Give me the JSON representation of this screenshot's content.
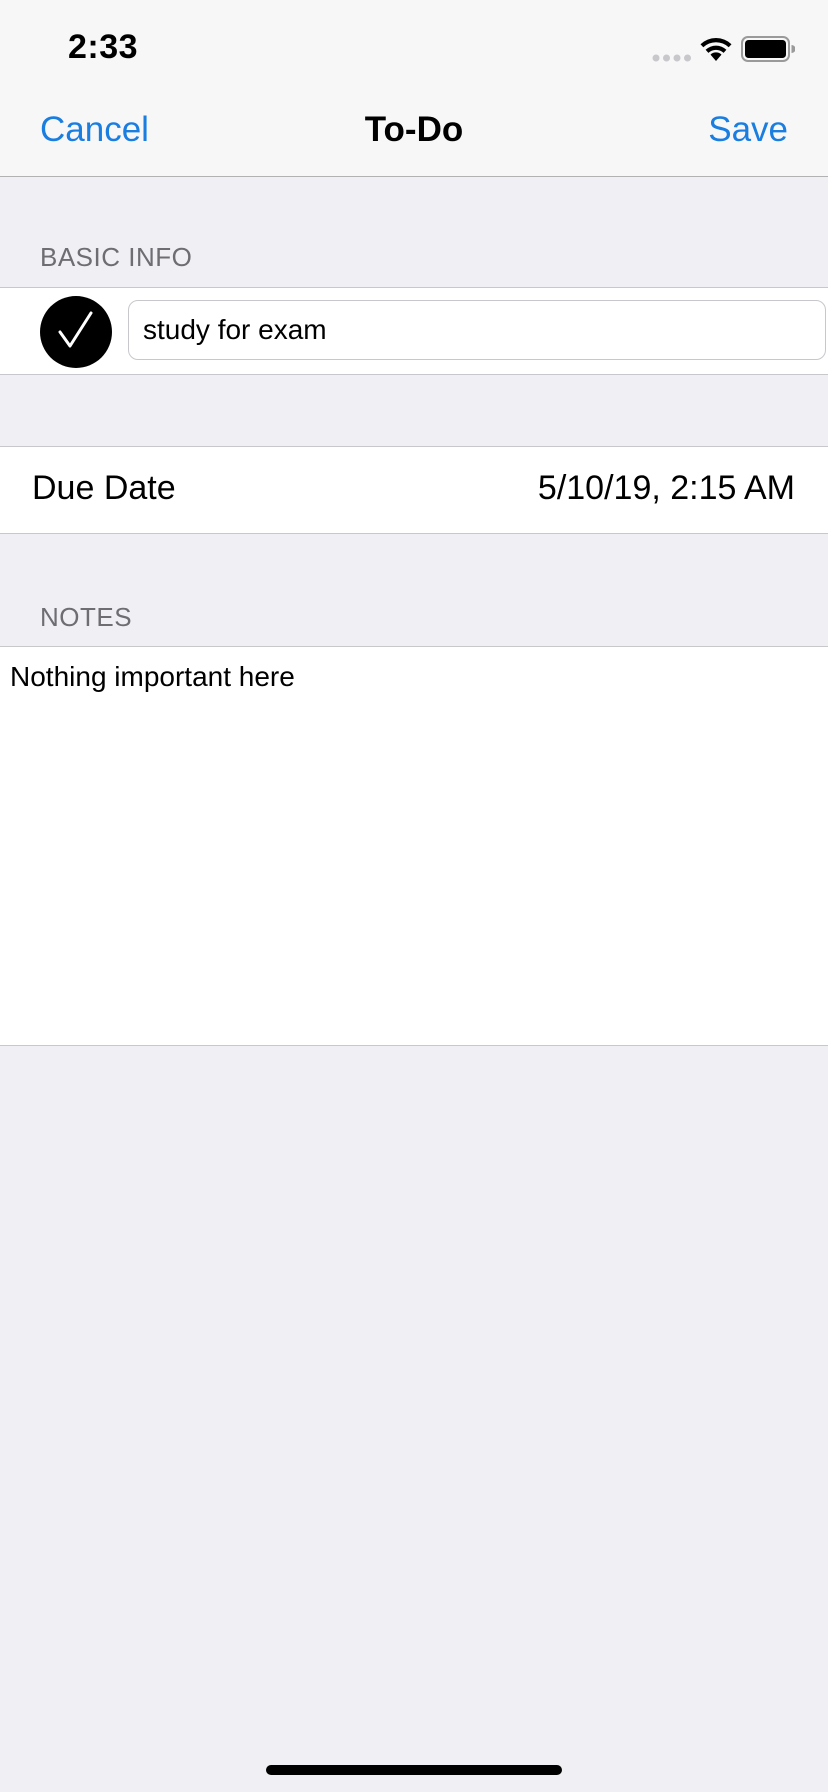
{
  "status_bar": {
    "time": "2:33",
    "icons": [
      "signal-icon",
      "wifi-icon",
      "battery-icon"
    ]
  },
  "nav": {
    "cancel_label": "Cancel",
    "title": "To-Do",
    "save_label": "Save"
  },
  "basic_info": {
    "header": "BASIC INFO",
    "completed": true,
    "title_value": "study for exam"
  },
  "due_date": {
    "label": "Due Date",
    "value": "5/10/19, 2:15 AM"
  },
  "notes": {
    "header": "NOTES",
    "text": "Nothing important here"
  },
  "colors": {
    "accent": "#1a7de0",
    "background": "#efeff4",
    "cell": "#ffffff",
    "separator": "#c8c7cc",
    "section_header": "#6d6d72"
  }
}
